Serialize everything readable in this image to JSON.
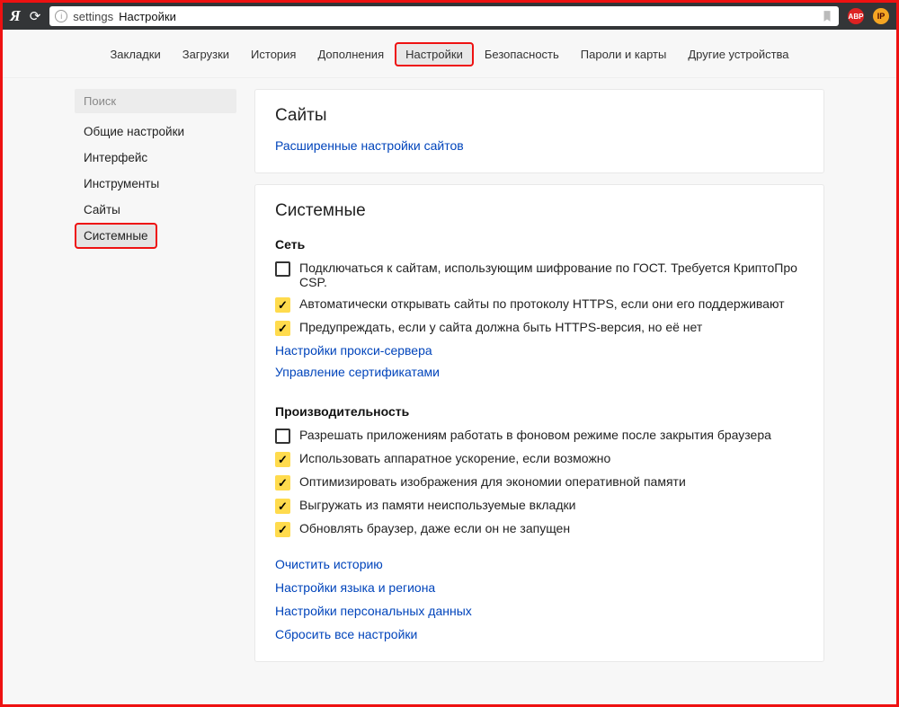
{
  "toolbar": {
    "logo": "Я",
    "address_prefix": "settings",
    "address_title": "Настройки"
  },
  "tabs": [
    {
      "label": "Закладки"
    },
    {
      "label": "Загрузки"
    },
    {
      "label": "История"
    },
    {
      "label": "Дополнения"
    },
    {
      "label": "Настройки",
      "active": true
    },
    {
      "label": "Безопасность"
    },
    {
      "label": "Пароли и карты"
    },
    {
      "label": "Другие устройства"
    }
  ],
  "sidebar": {
    "search_placeholder": "Поиск",
    "items": [
      {
        "label": "Общие настройки"
      },
      {
        "label": "Интерфейс"
      },
      {
        "label": "Инструменты"
      },
      {
        "label": "Сайты"
      },
      {
        "label": "Системные",
        "active": true
      }
    ]
  },
  "sites_card": {
    "heading": "Сайты",
    "advanced_link": "Расширенные настройки сайтов"
  },
  "system_card": {
    "heading": "Системные",
    "network": {
      "heading": "Сеть",
      "gost_label": "Подключаться к сайтам, использующим шифрование по ГОСТ. Требуется КриптоПро CSP.",
      "https_auto_label": "Автоматически открывать сайты по протоколу HTTPS, если они его поддерживают",
      "https_warn_label": "Предупреждать, если у сайта должна быть HTTPS-версия, но её нет",
      "proxy_link": "Настройки прокси-сервера",
      "certs_link": "Управление сертификатами"
    },
    "perf": {
      "heading": "Производительность",
      "bg_apps_label": "Разрешать приложениям работать в фоновом режиме после закрытия браузера",
      "hw_accel_label": "Использовать аппаратное ускорение, если возможно",
      "optimize_img_label": "Оптимизировать изображения для экономии оперативной памяти",
      "unload_tabs_label": "Выгружать из памяти неиспользуемые вкладки",
      "auto_update_label": "Обновлять браузер, даже если он не запущен"
    },
    "footer_links": {
      "clear_history": "Очистить историю",
      "lang_region": "Настройки языка и региона",
      "personal_data": "Настройки персональных данных",
      "reset_all": "Сбросить все настройки"
    }
  },
  "ext_badges": {
    "abp": "ABP",
    "ip": "IP"
  }
}
